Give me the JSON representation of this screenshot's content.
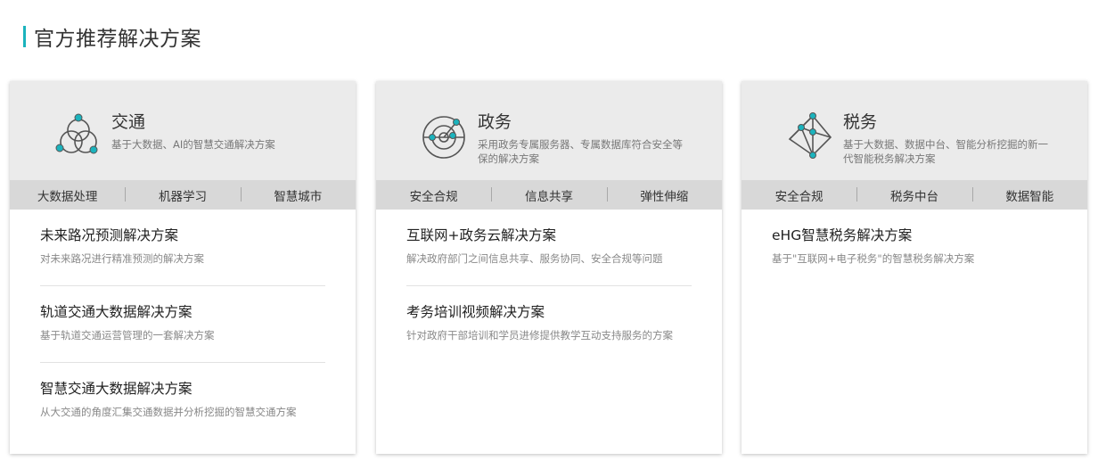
{
  "section": {
    "title": "官方推荐解决方案"
  },
  "colors": {
    "accent": "#1bb3bd",
    "head_bg": "#ebebeb",
    "tag_bg": "#d8d8d8"
  },
  "cards": [
    {
      "icon": "venn-network-icon",
      "title": "交通",
      "desc": "基于大数据、AI的智慧交通解决方案",
      "tags": [
        "大数据处理",
        "机器学习",
        "智慧城市"
      ],
      "items": [
        {
          "title": "未来路况预测解决方案",
          "desc": "对未来路况进行精准预测的解决方案"
        },
        {
          "title": "轨道交通大数据解决方案",
          "desc": "基于轨道交通运营管理的一套解决方案"
        },
        {
          "title": "智慧交通大数据解决方案",
          "desc": "从大交通的角度汇集交通数据并分析挖掘的智慧交通方案"
        }
      ]
    },
    {
      "icon": "radar-icon",
      "title": "政务",
      "desc": "采用政务专属服务器、专属数据库符合安全等保的解决方案",
      "tags": [
        "安全合规",
        "信息共享",
        "弹性伸缩"
      ],
      "items": [
        {
          "title": "互联网+政务云解决方案",
          "desc": "解决政府部门之间信息共享、服务协同、安全合规等问题"
        },
        {
          "title": "考务培训视频解决方案",
          "desc": "针对政府干部培训和学员进修提供教学互动支持服务的方案"
        }
      ]
    },
    {
      "icon": "network-graph-icon",
      "title": "税务",
      "desc": "基于大数据、数据中台、智能分析挖掘的新一代智能税务解决方案",
      "tags": [
        "安全合规",
        "税务中台",
        "数据智能"
      ],
      "items": [
        {
          "title": "eHG智慧税务解决方案",
          "desc": "基于\"互联网+电子税务\"的智慧税务解决方案"
        }
      ]
    }
  ]
}
